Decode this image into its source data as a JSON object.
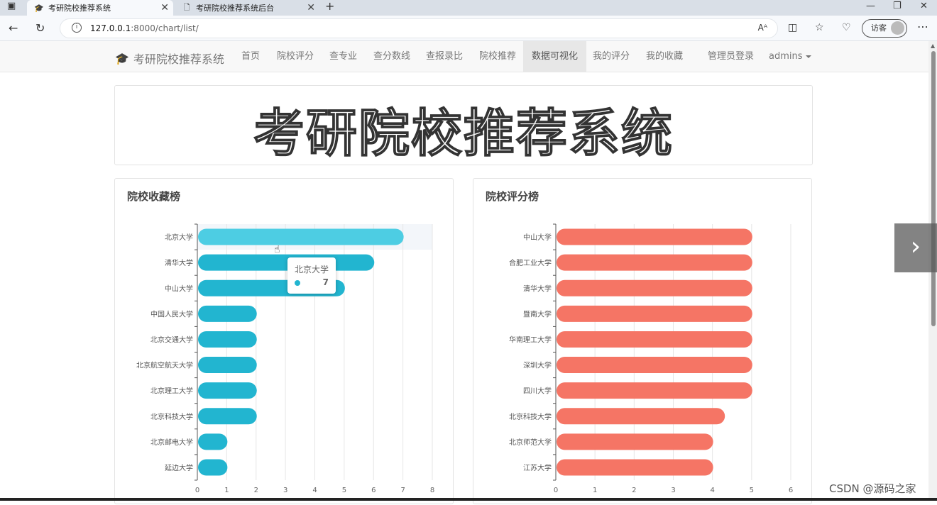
{
  "browser": {
    "tabs": [
      {
        "title": "考研院校推荐系统",
        "active": true,
        "icon": "graduation-cap-icon"
      },
      {
        "title": "考研院校推荐系统后台",
        "active": false,
        "icon": "page-icon"
      }
    ],
    "url_host": "127.0.0.1",
    "url_rest": ":8000/chart/list/",
    "visitor_label": "访客"
  },
  "navbar": {
    "brand": "考研院校推荐系统",
    "items": [
      "首页",
      "院校评分",
      "查专业",
      "查分数线",
      "查报录比",
      "院校推荐",
      "数据可视化",
      "我的评分",
      "我的收藏"
    ],
    "active_item": "数据可视化",
    "admin_login": "管理员登录",
    "user": "admins"
  },
  "hero": {
    "title": "考研院校推荐系统"
  },
  "tooltip": {
    "name": "北京大学",
    "value": "7"
  },
  "watermark": "CSDN @源码之家",
  "chart_data": [
    {
      "type": "bar",
      "orientation": "horizontal",
      "title": "院校收藏榜",
      "categories": [
        "北京大学",
        "清华大学",
        "中山大学",
        "中国人民大学",
        "北京交通大学",
        "北京航空航天大学",
        "北京理工大学",
        "北京科技大学",
        "北京邮电大学",
        "延边大学"
      ],
      "values": [
        7,
        6,
        5,
        2,
        2,
        2,
        2,
        2,
        1,
        1
      ],
      "xlim": [
        0,
        8
      ],
      "xticks": [
        0,
        1,
        2,
        3,
        4,
        5,
        6,
        7,
        8
      ],
      "color": "#22b5d0",
      "highlight_color": "#4dcde3",
      "highlighted": "北京大学",
      "grid": true
    },
    {
      "type": "bar",
      "orientation": "horizontal",
      "title": "院校评分榜",
      "categories": [
        "中山大学",
        "合肥工业大学",
        "清华大学",
        "暨南大学",
        "华南理工大学",
        "深圳大学",
        "四川大学",
        "北京科技大学",
        "北京师范大学",
        "江苏大学"
      ],
      "values": [
        5,
        5,
        5,
        5,
        5,
        5,
        5,
        4.3,
        4,
        4
      ],
      "xlim": [
        0,
        6
      ],
      "xticks": [
        0,
        1,
        2,
        3,
        4,
        5,
        6
      ],
      "color": "#f57565",
      "grid": true
    }
  ]
}
